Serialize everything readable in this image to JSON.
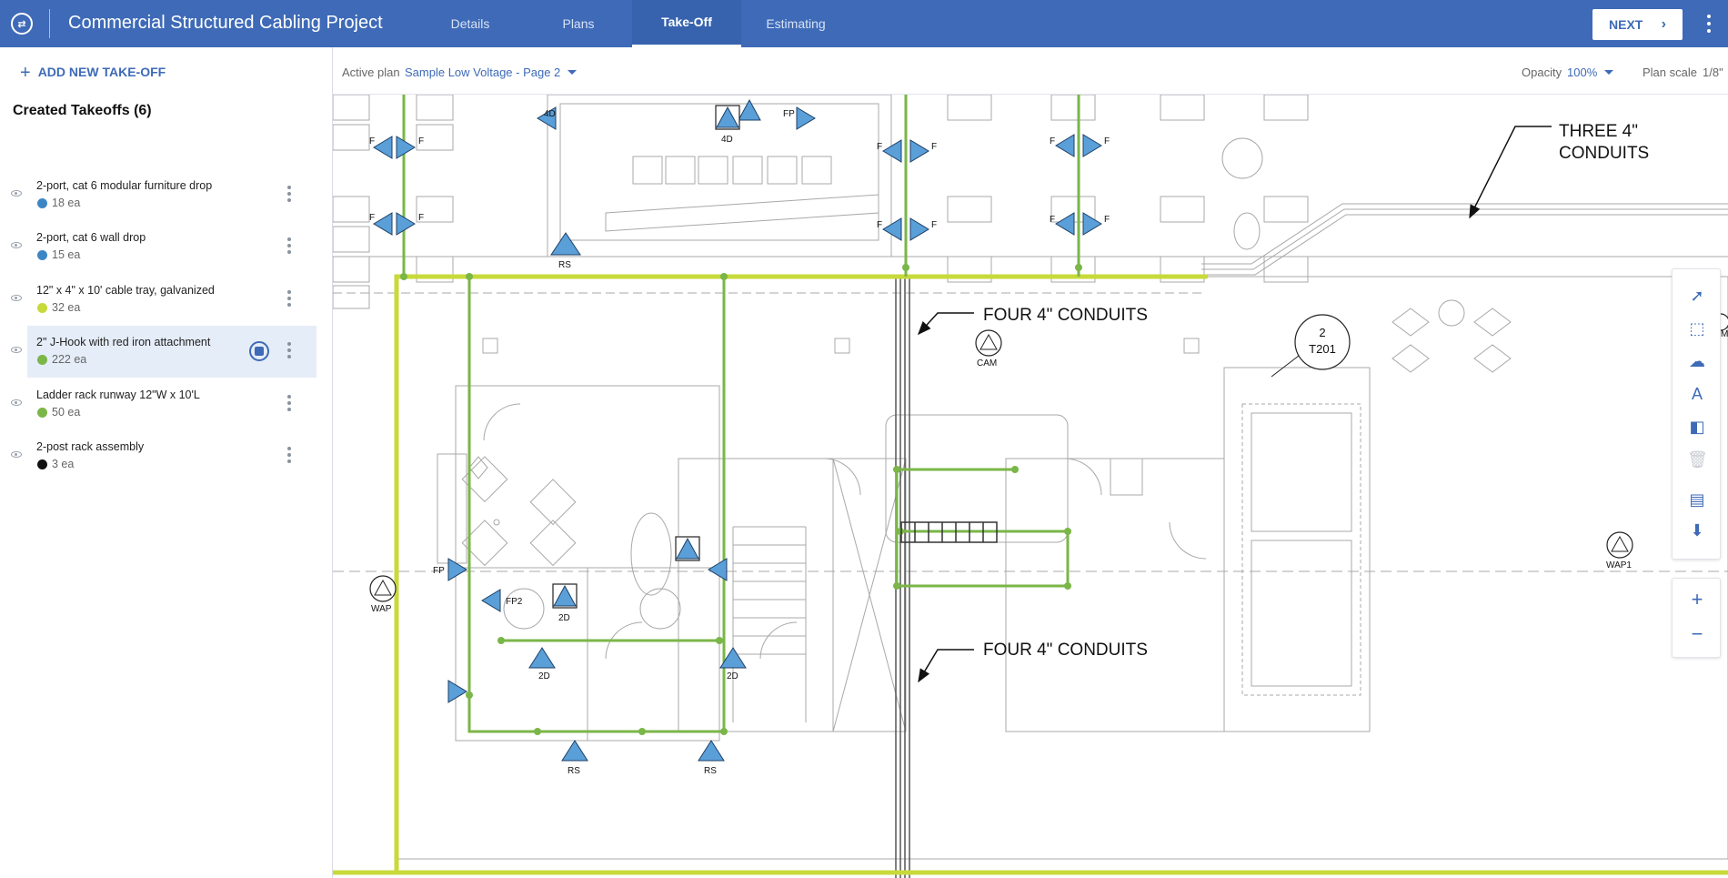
{
  "header": {
    "logo_icon": "app-logo-icon",
    "title": "Commercial Structured Cabling Project",
    "tabs": [
      {
        "label": "Details",
        "active": false
      },
      {
        "label": "Plans",
        "active": false
      },
      {
        "label": "Take-Off",
        "active": true
      },
      {
        "label": "Estimating",
        "active": false
      }
    ],
    "next_label": "NEXT",
    "accent": "#3e6ab7"
  },
  "sidebar": {
    "add_label": "ADD NEW TAKE-OFF",
    "created_title": "Created Takeoffs (6)",
    "items": [
      {
        "name": "2-port, cat 6 modular furniture drop",
        "qty": "18 ea",
        "color": "#3d86c6",
        "selected": false
      },
      {
        "name": "2-port, cat 6 wall drop",
        "qty": "15 ea",
        "color": "#3d86c6",
        "selected": false
      },
      {
        "name": "12\" x 4\" x 10' cable tray, galvanized",
        "qty": "32 ea",
        "color": "#c8d93a",
        "selected": false
      },
      {
        "name": "2\" J-Hook with red iron attachment",
        "qty": "222 ea",
        "color": "#7ab648",
        "selected": true
      },
      {
        "name": "Ladder rack runway 12\"W x 10'L",
        "qty": "50 ea",
        "color": "#7ab648",
        "selected": false
      },
      {
        "name": "2-post rack assembly",
        "qty": "3 ea",
        "color": "#111111",
        "selected": false
      }
    ]
  },
  "plan_bar": {
    "active_plan_label": "Active plan",
    "active_plan_value": "Sample Low Voltage - Page 2",
    "opacity_label": "Opacity",
    "opacity_value": "100%",
    "scale_label": "Plan scale",
    "scale_value": "1/8\""
  },
  "plan": {
    "annotations": {
      "three_conduits_1": "THREE 4\"",
      "three_conduits_2": "CONDUITS",
      "four_conduits_a": "FOUR 4\" CONDUITS",
      "four_conduits_b": "FOUR 4\" CONDUITS",
      "tag_top": "2",
      "tag_bottom": "T201"
    },
    "device_labels": {
      "d_4d_a": "4D",
      "d_4d_b": "4D",
      "d_fp_top": "FP",
      "d_rs_top": "RS",
      "d_cam": "CAM",
      "d_wap": "WAP",
      "d_wap1": "WAP1",
      "d_fp_left": "FP",
      "d_fp2": "FP2",
      "d_2d_a": "2D",
      "d_2d_b": "2D",
      "d_2d_c": "2D",
      "d_rs_b1": "RS",
      "d_rs_b2": "RS",
      "d_m": "M",
      "f_a": "F",
      "f_b": "F",
      "f_c": "F",
      "f_d": "F",
      "f_e": "F",
      "f_f": "F",
      "f_g": "F",
      "f_h": "F",
      "f_i": "F",
      "f_j": "F",
      "f_k": "F",
      "f_l": "F"
    },
    "colors": {
      "jhook": "#7ab648",
      "tray": "#c8d93a",
      "device": "#5a9fd8",
      "line": "#9a9a9a"
    }
  },
  "tools": {
    "select": "pointer-icon",
    "area": "area-select-icon",
    "cloud": "cloud-icon",
    "text": "text-icon",
    "compare": "compare-icon",
    "delete": "trash-icon",
    "notes": "notes-icon",
    "download": "download-icon",
    "zoom_in": "+",
    "zoom_out": "−"
  }
}
